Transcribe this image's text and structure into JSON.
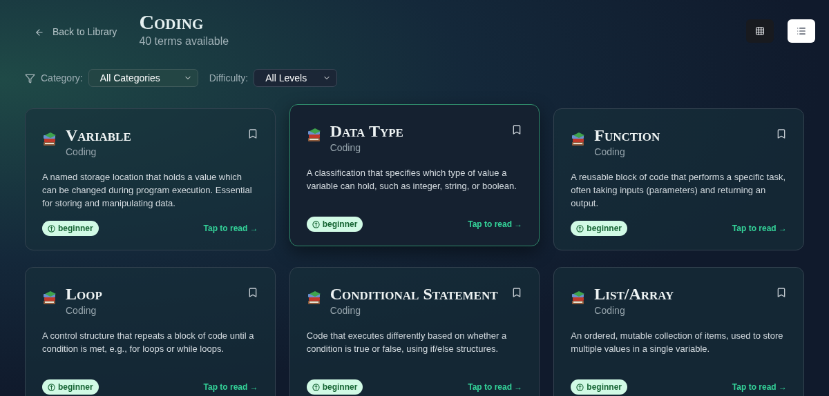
{
  "back_link": "Back to Library",
  "header": {
    "title": "Coding",
    "subtitle": "40 terms available"
  },
  "view_toggle": [
    {
      "kind": "grid",
      "selected": false
    },
    {
      "kind": "list",
      "selected": true
    }
  ],
  "filters": [
    {
      "label": "Category:",
      "value": "All Categories"
    },
    {
      "label": "Difficulty:",
      "value": "All Levels"
    }
  ],
  "cards": [
    {
      "title": "Variable",
      "category": "Coding",
      "description": "A named storage location that holds a value which can be changed during program execution. Essential for storing and manipulating data.",
      "level": "beginner",
      "action": "Tap to read →",
      "hovered": false
    },
    {
      "title": "Data Type",
      "category": "Coding",
      "description": "A classification that specifies which type of value a variable can hold, such as integer, string, or boolean.",
      "level": "beginner",
      "action": "Tap to read →",
      "hovered": true
    },
    {
      "title": "Function",
      "category": "Coding",
      "description": "A reusable block of code that performs a specific task, often taking inputs (parameters) and returning an output.",
      "level": "beginner",
      "action": "Tap to read →",
      "hovered": false
    },
    {
      "title": "Loop",
      "category": "Coding",
      "description": "A control structure that repeats a block of code until a condition is met, e.g., for loops or while loops.",
      "level": "beginner",
      "action": "Tap to read →",
      "hovered": false
    },
    {
      "title": "Conditional Statement",
      "category": "Coding",
      "description": "Code that executes differently based on whether a condition is true or false, using if/else structures.",
      "level": "beginner",
      "action": "Tap to read →",
      "hovered": false
    },
    {
      "title": "List/Array",
      "category": "Coding",
      "description": "An ordered, mutable collection of items, used to store multiple values in a single variable.",
      "level": "beginner",
      "action": "Tap to read →",
      "hovered": false
    }
  ]
}
